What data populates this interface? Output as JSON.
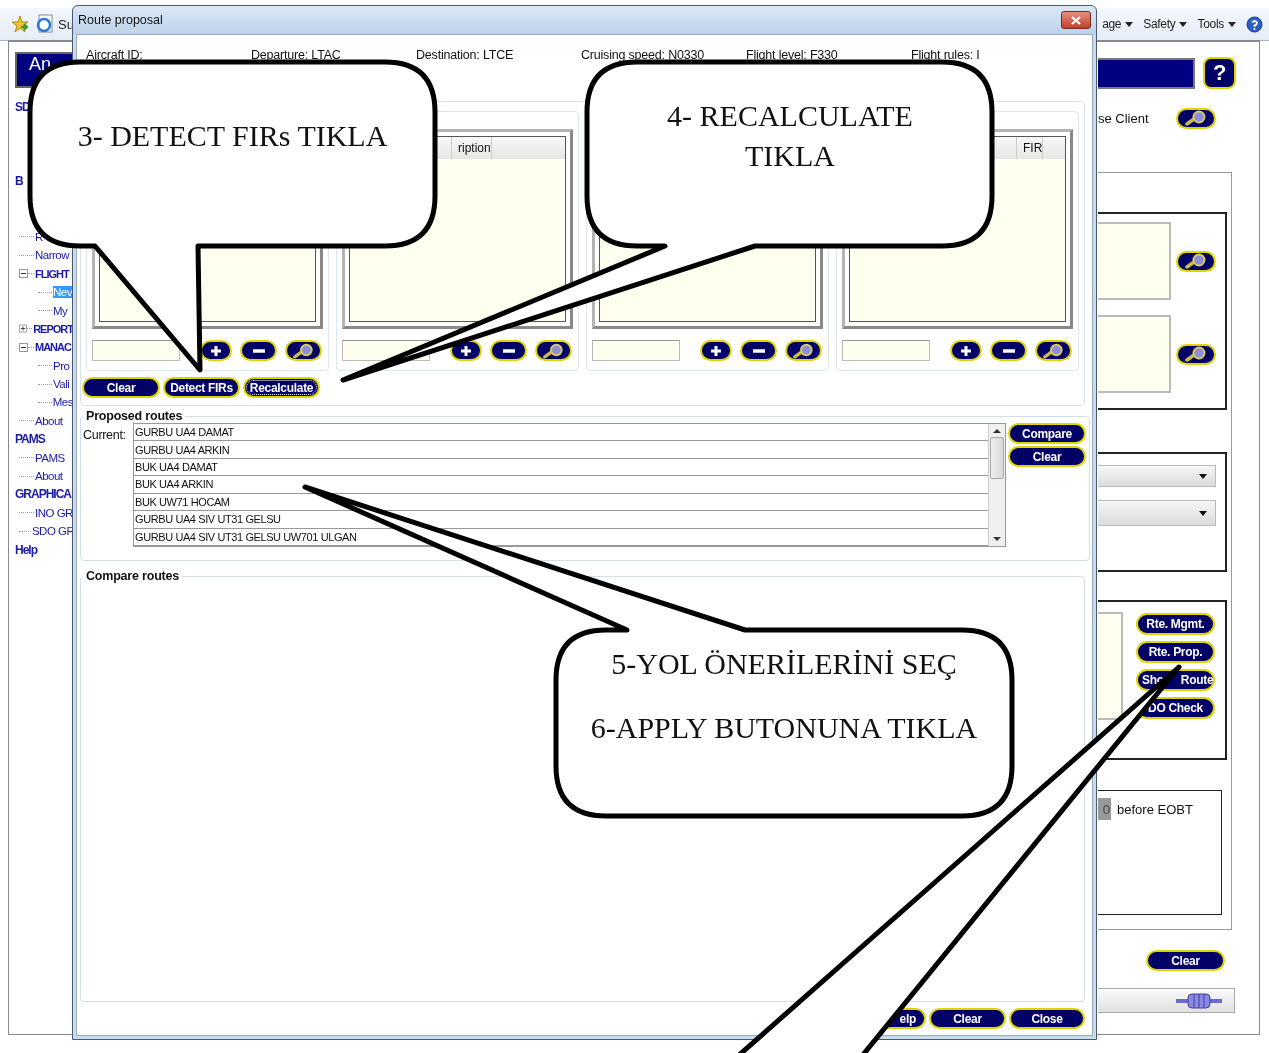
{
  "browser": {
    "tab_title": "Su",
    "commands": [
      "age",
      "Safety",
      "Tools"
    ]
  },
  "app": {
    "header": "An",
    "help_button": "?"
  },
  "sidebar": {
    "items": [
      {
        "label": "SD",
        "kind": "section"
      },
      {
        "label": "B",
        "kind": "section",
        "children": [
          {
            "label": "R",
            "kind": "leaf",
            "selected": false
          },
          {
            "label": "Narrow",
            "kind": "leaf",
            "selected": false
          },
          {
            "label": "FLIGHT",
            "kind": "folder",
            "expanded": true,
            "selected": false,
            "children": [
              {
                "label": "Nev",
                "kind": "leaf",
                "selected": true
              },
              {
                "label": "My",
                "kind": "leaf",
                "selected": false
              }
            ]
          },
          {
            "label": "REPORT",
            "kind": "folder",
            "expanded": false,
            "selected": false
          },
          {
            "label": "MANAC",
            "kind": "folder",
            "expanded": true,
            "selected": false,
            "children": [
              {
                "label": "Pro",
                "kind": "leaf",
                "selected": false
              },
              {
                "label": "Vali",
                "kind": "leaf",
                "selected": false
              },
              {
                "label": "Mes",
                "kind": "leaf",
                "selected": false
              }
            ]
          },
          {
            "label": "About",
            "kind": "leaf",
            "selected": false
          }
        ]
      },
      {
        "label": "PAMS",
        "kind": "section",
        "children": [
          {
            "label": "PAMS",
            "kind": "leaf",
            "selected": false
          },
          {
            "label": "About",
            "kind": "leaf",
            "selected": false
          }
        ]
      },
      {
        "label": "GRAPHICA",
        "kind": "section",
        "children": [
          {
            "label": "INO GR",
            "kind": "leaf",
            "selected": false
          },
          {
            "label": "SDO GF",
            "kind": "leaf",
            "selected": false
          }
        ]
      },
      {
        "label": "Help",
        "kind": "section"
      }
    ]
  },
  "right_pane": {
    "client_label": "se Client",
    "route_buttons": [
      "Rte. Mgmt.",
      "Rte. Prop.",
      "Sho Route",
      "DO Check"
    ],
    "eobt": {
      "value": "0",
      "label": "before EOBT"
    },
    "clear_button": "Clear"
  },
  "dialog": {
    "title": "Route proposal",
    "flight_info": [
      "Aircraft ID:",
      "Departure: LTAC",
      "Destination: LTCE",
      "Cruising speed: N0330",
      "Flight level: F330",
      "Flight rules: I"
    ],
    "fir_panels": [
      {
        "kind": "table"
      },
      {
        "kind": "table",
        "columns": [
          "ription"
        ]
      },
      {
        "kind": "table"
      },
      {
        "kind": "table",
        "columns": [
          "FIR"
        ]
      }
    ],
    "actions": [
      {
        "label": "Clear",
        "focused": false
      },
      {
        "label": "Detect FIRs",
        "focused": false
      },
      {
        "label": "Recalculate",
        "focused": true
      }
    ],
    "proposed_routes": {
      "title": "Proposed routes",
      "current_label": "Current:",
      "routes": [
        {
          "text": "GURBU UA4 DAMAT",
          "selected": false
        },
        {
          "text": "GURBU UA4 ARKIN",
          "selected": false
        },
        {
          "text": "BUK UA4 DAMAT",
          "selected": false
        },
        {
          "text": "BUK UA4 ARKIN",
          "selected": false
        },
        {
          "text": "BUK UW71 HOCAM",
          "selected": false
        },
        {
          "text": "GURBU UA4 SIV UT31 GELSU",
          "selected": false
        },
        {
          "text": "GURBU UA4 SIV UT31 GELSU UW701 ULGAN",
          "selected": false
        }
      ],
      "buttons": [
        "Compare",
        "Clear"
      ]
    },
    "compare_routes": {
      "title": "Compare routes"
    },
    "footer_buttons": [
      "elp",
      "Clear",
      "Close"
    ]
  },
  "callouts": [
    {
      "lines": [
        "3- DETECT FIRs TIKLA"
      ]
    },
    {
      "lines": [
        "4- RECALCULATE TIKLA"
      ]
    },
    {
      "lines": [
        "5-YOL ÖNERİLERİNİ SEÇ",
        "6-APPLY BUTONUNA TIKLA"
      ]
    }
  ]
}
